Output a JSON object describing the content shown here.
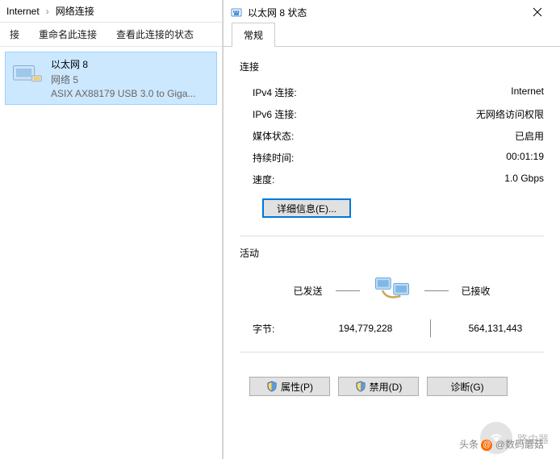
{
  "breadcrumb": {
    "seg1": "Internet",
    "sep": "›",
    "seg2": "网络连接"
  },
  "toolbar": {
    "item1": "接",
    "item2": "重命名此连接",
    "item3": "查看此连接的状态"
  },
  "adapter": {
    "name": "以太网 8",
    "network": "网络 5",
    "device": "ASIX AX88179 USB 3.0 to Giga..."
  },
  "dialog": {
    "title": "以太网 8 状态",
    "tab": "常规",
    "section_connection": "连接",
    "rows": {
      "ipv4_k": "IPv4 连接:",
      "ipv4_v": "Internet",
      "ipv6_k": "IPv6 连接:",
      "ipv6_v": "无网络访问权限",
      "media_k": "媒体状态:",
      "media_v": "已启用",
      "duration_k": "持续时间:",
      "duration_v": "00:01:19",
      "speed_k": "速度:",
      "speed_v": "1.0 Gbps"
    },
    "details_btn": "详细信息(E)...",
    "section_activity": "活动",
    "activity": {
      "sent": "已发送",
      "recv": "已接收"
    },
    "bytes": {
      "label": "字节:",
      "sent": "194,779,228",
      "recv": "564,131,443"
    },
    "buttons": {
      "prop": "属性(P)",
      "disable": "禁用(D)",
      "diag": "诊断(G)"
    }
  },
  "watermark": {
    "side": "路由器",
    "bottom_prefix": "头条",
    "bottom_at": "@数码蘑菇"
  }
}
